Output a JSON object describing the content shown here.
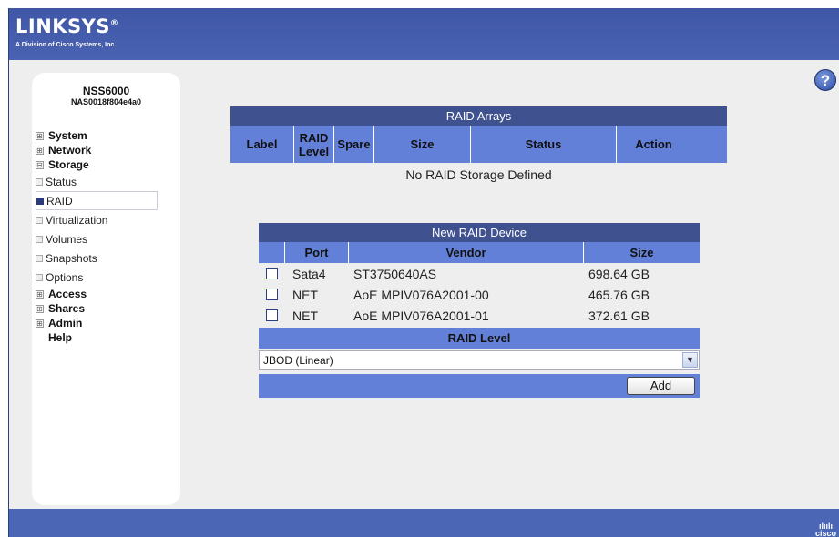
{
  "header": {
    "logo": "LINKSYS",
    "logo_sub": "A Division of Cisco Systems, Inc.",
    "registered": "®"
  },
  "help": {
    "label": "?"
  },
  "sidebar": {
    "device_name": "NSS6000",
    "device_id": "NAS0018f804e4a0",
    "items": [
      {
        "label": "System",
        "expander": "⊞"
      },
      {
        "label": "Network",
        "expander": "⊞"
      },
      {
        "label": "Storage",
        "expander": "⊟"
      },
      {
        "label": "Status"
      },
      {
        "label": "RAID"
      },
      {
        "label": "Virtualization"
      },
      {
        "label": "Volumes"
      },
      {
        "label": "Snapshots"
      },
      {
        "label": "Options"
      },
      {
        "label": "Access",
        "expander": "⊞"
      },
      {
        "label": "Shares",
        "expander": "⊞"
      },
      {
        "label": "Admin",
        "expander": "⊞"
      },
      {
        "label": "Help"
      }
    ]
  },
  "raid_arrays": {
    "title": "RAID Arrays",
    "columns": [
      "Label",
      "RAID Level",
      "Spare",
      "Size",
      "Status",
      "Action"
    ],
    "empty_message": "No RAID Storage Defined"
  },
  "new_raid": {
    "title": "New RAID Device",
    "columns": [
      "",
      "Port",
      "Vendor",
      "Size"
    ],
    "devices": [
      {
        "port": "Sata4",
        "vendor": "ST3750640AS",
        "size": "698.64 GB"
      },
      {
        "port": "NET",
        "vendor": "AoE MPIV076A2001-00",
        "size": "465.76 GB"
      },
      {
        "port": "NET",
        "vendor": "AoE MPIV076A2001-01",
        "size": "372.61 GB"
      }
    ],
    "raid_level_label": "RAID Level",
    "raid_level_value": "JBOD (Linear)",
    "add_label": "Add"
  },
  "footer": {
    "brand_top": "ılıılı",
    "brand": "cisco"
  },
  "colors": {
    "header_blue": "#4b66b5",
    "table_title": "#3f518f",
    "table_header": "#6380d8",
    "content_bg": "#eeeeee"
  }
}
